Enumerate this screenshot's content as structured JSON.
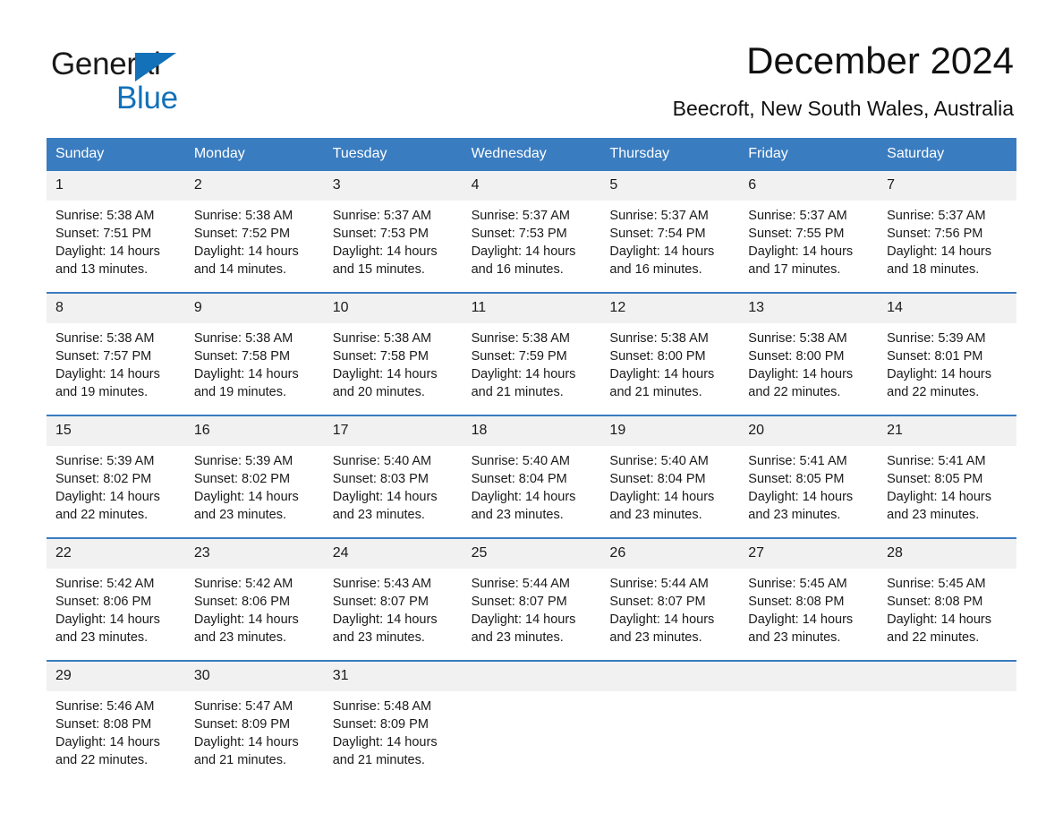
{
  "logo": {
    "text_primary": "General",
    "text_secondary": "Blue",
    "triangle_color": "#1271b8"
  },
  "header": {
    "month_title": "December 2024",
    "location": "Beecroft, New South Wales, Australia"
  },
  "theme": {
    "header_blue": "#3a7cc0",
    "daynum_bg": "#f1f1f1",
    "text": "#1a1a1a"
  },
  "weekdays": [
    "Sunday",
    "Monday",
    "Tuesday",
    "Wednesday",
    "Thursday",
    "Friday",
    "Saturday"
  ],
  "weeks": [
    [
      {
        "day": "1",
        "sunrise": "Sunrise: 5:38 AM",
        "sunset": "Sunset: 7:51 PM",
        "daylight_line1": "Daylight: 14 hours",
        "daylight_line2": "and 13 minutes."
      },
      {
        "day": "2",
        "sunrise": "Sunrise: 5:38 AM",
        "sunset": "Sunset: 7:52 PM",
        "daylight_line1": "Daylight: 14 hours",
        "daylight_line2": "and 14 minutes."
      },
      {
        "day": "3",
        "sunrise": "Sunrise: 5:37 AM",
        "sunset": "Sunset: 7:53 PM",
        "daylight_line1": "Daylight: 14 hours",
        "daylight_line2": "and 15 minutes."
      },
      {
        "day": "4",
        "sunrise": "Sunrise: 5:37 AM",
        "sunset": "Sunset: 7:53 PM",
        "daylight_line1": "Daylight: 14 hours",
        "daylight_line2": "and 16 minutes."
      },
      {
        "day": "5",
        "sunrise": "Sunrise: 5:37 AM",
        "sunset": "Sunset: 7:54 PM",
        "daylight_line1": "Daylight: 14 hours",
        "daylight_line2": "and 16 minutes."
      },
      {
        "day": "6",
        "sunrise": "Sunrise: 5:37 AM",
        "sunset": "Sunset: 7:55 PM",
        "daylight_line1": "Daylight: 14 hours",
        "daylight_line2": "and 17 minutes."
      },
      {
        "day": "7",
        "sunrise": "Sunrise: 5:37 AM",
        "sunset": "Sunset: 7:56 PM",
        "daylight_line1": "Daylight: 14 hours",
        "daylight_line2": "and 18 minutes."
      }
    ],
    [
      {
        "day": "8",
        "sunrise": "Sunrise: 5:38 AM",
        "sunset": "Sunset: 7:57 PM",
        "daylight_line1": "Daylight: 14 hours",
        "daylight_line2": "and 19 minutes."
      },
      {
        "day": "9",
        "sunrise": "Sunrise: 5:38 AM",
        "sunset": "Sunset: 7:58 PM",
        "daylight_line1": "Daylight: 14 hours",
        "daylight_line2": "and 19 minutes."
      },
      {
        "day": "10",
        "sunrise": "Sunrise: 5:38 AM",
        "sunset": "Sunset: 7:58 PM",
        "daylight_line1": "Daylight: 14 hours",
        "daylight_line2": "and 20 minutes."
      },
      {
        "day": "11",
        "sunrise": "Sunrise: 5:38 AM",
        "sunset": "Sunset: 7:59 PM",
        "daylight_line1": "Daylight: 14 hours",
        "daylight_line2": "and 21 minutes."
      },
      {
        "day": "12",
        "sunrise": "Sunrise: 5:38 AM",
        "sunset": "Sunset: 8:00 PM",
        "daylight_line1": "Daylight: 14 hours",
        "daylight_line2": "and 21 minutes."
      },
      {
        "day": "13",
        "sunrise": "Sunrise: 5:38 AM",
        "sunset": "Sunset: 8:00 PM",
        "daylight_line1": "Daylight: 14 hours",
        "daylight_line2": "and 22 minutes."
      },
      {
        "day": "14",
        "sunrise": "Sunrise: 5:39 AM",
        "sunset": "Sunset: 8:01 PM",
        "daylight_line1": "Daylight: 14 hours",
        "daylight_line2": "and 22 minutes."
      }
    ],
    [
      {
        "day": "15",
        "sunrise": "Sunrise: 5:39 AM",
        "sunset": "Sunset: 8:02 PM",
        "daylight_line1": "Daylight: 14 hours",
        "daylight_line2": "and 22 minutes."
      },
      {
        "day": "16",
        "sunrise": "Sunrise: 5:39 AM",
        "sunset": "Sunset: 8:02 PM",
        "daylight_line1": "Daylight: 14 hours",
        "daylight_line2": "and 23 minutes."
      },
      {
        "day": "17",
        "sunrise": "Sunrise: 5:40 AM",
        "sunset": "Sunset: 8:03 PM",
        "daylight_line1": "Daylight: 14 hours",
        "daylight_line2": "and 23 minutes."
      },
      {
        "day": "18",
        "sunrise": "Sunrise: 5:40 AM",
        "sunset": "Sunset: 8:04 PM",
        "daylight_line1": "Daylight: 14 hours",
        "daylight_line2": "and 23 minutes."
      },
      {
        "day": "19",
        "sunrise": "Sunrise: 5:40 AM",
        "sunset": "Sunset: 8:04 PM",
        "daylight_line1": "Daylight: 14 hours",
        "daylight_line2": "and 23 minutes."
      },
      {
        "day": "20",
        "sunrise": "Sunrise: 5:41 AM",
        "sunset": "Sunset: 8:05 PM",
        "daylight_line1": "Daylight: 14 hours",
        "daylight_line2": "and 23 minutes."
      },
      {
        "day": "21",
        "sunrise": "Sunrise: 5:41 AM",
        "sunset": "Sunset: 8:05 PM",
        "daylight_line1": "Daylight: 14 hours",
        "daylight_line2": "and 23 minutes."
      }
    ],
    [
      {
        "day": "22",
        "sunrise": "Sunrise: 5:42 AM",
        "sunset": "Sunset: 8:06 PM",
        "daylight_line1": "Daylight: 14 hours",
        "daylight_line2": "and 23 minutes."
      },
      {
        "day": "23",
        "sunrise": "Sunrise: 5:42 AM",
        "sunset": "Sunset: 8:06 PM",
        "daylight_line1": "Daylight: 14 hours",
        "daylight_line2": "and 23 minutes."
      },
      {
        "day": "24",
        "sunrise": "Sunrise: 5:43 AM",
        "sunset": "Sunset: 8:07 PM",
        "daylight_line1": "Daylight: 14 hours",
        "daylight_line2": "and 23 minutes."
      },
      {
        "day": "25",
        "sunrise": "Sunrise: 5:44 AM",
        "sunset": "Sunset: 8:07 PM",
        "daylight_line1": "Daylight: 14 hours",
        "daylight_line2": "and 23 minutes."
      },
      {
        "day": "26",
        "sunrise": "Sunrise: 5:44 AM",
        "sunset": "Sunset: 8:07 PM",
        "daylight_line1": "Daylight: 14 hours",
        "daylight_line2": "and 23 minutes."
      },
      {
        "day": "27",
        "sunrise": "Sunrise: 5:45 AM",
        "sunset": "Sunset: 8:08 PM",
        "daylight_line1": "Daylight: 14 hours",
        "daylight_line2": "and 23 minutes."
      },
      {
        "day": "28",
        "sunrise": "Sunrise: 5:45 AM",
        "sunset": "Sunset: 8:08 PM",
        "daylight_line1": "Daylight: 14 hours",
        "daylight_line2": "and 22 minutes."
      }
    ],
    [
      {
        "day": "29",
        "sunrise": "Sunrise: 5:46 AM",
        "sunset": "Sunset: 8:08 PM",
        "daylight_line1": "Daylight: 14 hours",
        "daylight_line2": "and 22 minutes."
      },
      {
        "day": "30",
        "sunrise": "Sunrise: 5:47 AM",
        "sunset": "Sunset: 8:09 PM",
        "daylight_line1": "Daylight: 14 hours",
        "daylight_line2": "and 21 minutes."
      },
      {
        "day": "31",
        "sunrise": "Sunrise: 5:48 AM",
        "sunset": "Sunset: 8:09 PM",
        "daylight_line1": "Daylight: 14 hours",
        "daylight_line2": "and 21 minutes."
      },
      {
        "day": "",
        "sunrise": "",
        "sunset": "",
        "daylight_line1": "",
        "daylight_line2": ""
      },
      {
        "day": "",
        "sunrise": "",
        "sunset": "",
        "daylight_line1": "",
        "daylight_line2": ""
      },
      {
        "day": "",
        "sunrise": "",
        "sunset": "",
        "daylight_line1": "",
        "daylight_line2": ""
      },
      {
        "day": "",
        "sunrise": "",
        "sunset": "",
        "daylight_line1": "",
        "daylight_line2": ""
      }
    ]
  ]
}
